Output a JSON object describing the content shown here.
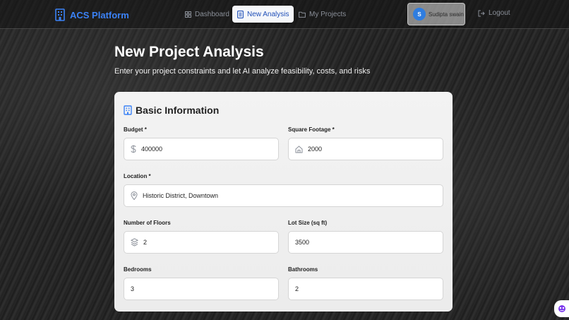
{
  "brand": {
    "name": "ACS Platform"
  },
  "nav": {
    "dashboard": "Dashboard",
    "new_analysis": "New Analysis",
    "my_projects": "My Projects"
  },
  "user": {
    "initial": "S",
    "name": "Sudipta swain"
  },
  "logout": "Logout",
  "page": {
    "title": "New Project Analysis",
    "subtitle": "Enter your project constraints and let AI analyze feasibility, costs, and risks"
  },
  "section": {
    "title": "Basic Information"
  },
  "fields": {
    "budget": {
      "label": "Budget *",
      "value": "400000"
    },
    "square_footage": {
      "label": "Square Footage *",
      "value": "2000"
    },
    "location": {
      "label": "Location *",
      "value": "Historic District, Downtown"
    },
    "floors": {
      "label": "Number of Floors",
      "value": "2"
    },
    "lot_size": {
      "label": "Lot Size (sq ft)",
      "value": "3500"
    },
    "bedrooms": {
      "label": "Bedrooms",
      "value": "3"
    },
    "bathrooms": {
      "label": "Bathrooms",
      "value": "2"
    }
  },
  "colors": {
    "accent": "#3b82f6",
    "active_text": "#1f4fb8",
    "avatar": "#2f7de0"
  },
  "icons": [
    "building-icon",
    "grid-icon",
    "document-icon",
    "folder-icon",
    "logout-icon",
    "dollar-icon",
    "home-icon",
    "map-pin-icon",
    "layers-icon",
    "chat-widget-icon"
  ]
}
